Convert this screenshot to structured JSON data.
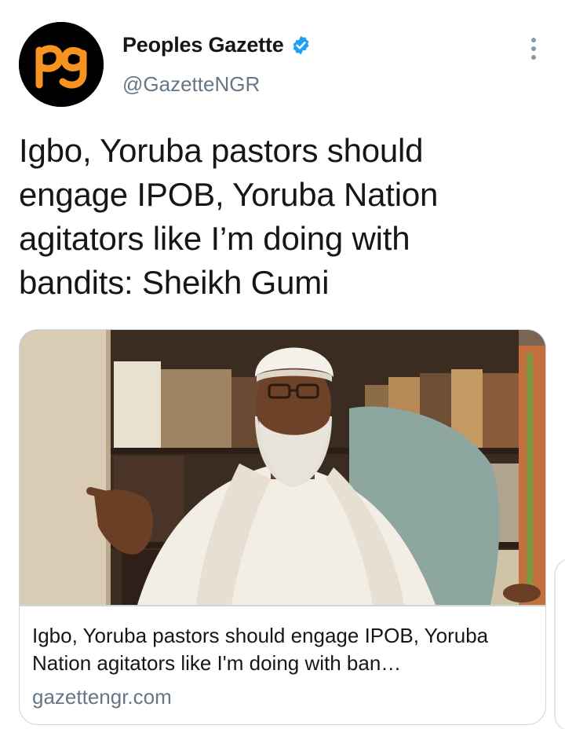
{
  "author": {
    "name": "Peoples Gazette",
    "handle": "@GazetteNGR",
    "verified": true,
    "avatar_text": "pg",
    "avatar_bg": "#000000",
    "avatar_fg": "#f7931e"
  },
  "tweet": {
    "text": "Igbo, Yoruba pastors should engage IPOB, Yoruba Nation agitators like I’m doing with bandits: Sheikh Gumi"
  },
  "card": {
    "title": "Igbo, Yoruba pastors should engage IPOB, Yoruba Nation agitators like I'm doing with ban…",
    "domain": "gazettengr.com",
    "image_icon": "photo-of-man-in-white-turban-before-bookshelves"
  },
  "icons": {
    "more": "more-vertical-icon",
    "verified": "verified-badge-icon"
  },
  "colors": {
    "verified_blue": "#1da1f2",
    "secondary_text": "#657786",
    "border": "#ccd6dd"
  }
}
